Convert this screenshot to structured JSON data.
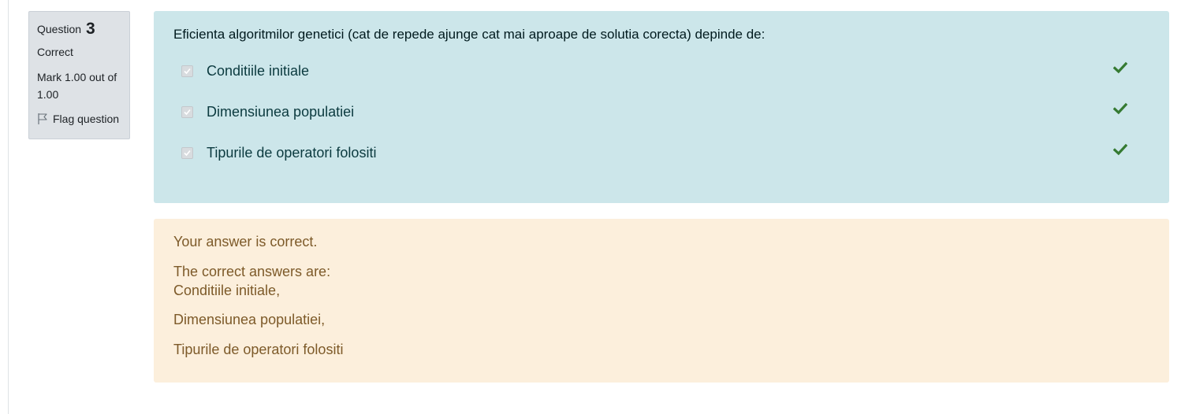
{
  "question_info": {
    "question_label": "Question",
    "question_number": "3",
    "state": "Correct",
    "grade": "Mark 1.00 out of 1.00",
    "flag_label": "Flag question"
  },
  "question": {
    "text": "Eficienta algoritmilor genetici (cat de repede ajunge cat mai aproape de solutia corecta) depinde de:",
    "answers": [
      {
        "label": "Conditiile initiale",
        "checked": true,
        "correct": true
      },
      {
        "label": "Dimensiunea populatiei",
        "checked": true,
        "correct": true
      },
      {
        "label": "Tipurile de operatori folositi",
        "checked": true,
        "correct": true
      }
    ]
  },
  "feedback": {
    "general": "Your answer is correct.",
    "heading": "The correct answers are:",
    "items": [
      "Conditiile initiale,",
      "Dimensiunea populatiei,",
      "Tipurile de operatori folositi"
    ]
  },
  "colors": {
    "question_bg": "#cce6ea",
    "feedback_bg": "#fcefdc",
    "info_bg": "#dee2e6",
    "correct_tick": "#357a32",
    "feedback_text": "#7d5a29"
  },
  "icons": {
    "flag": "flag-icon",
    "correct": "check-icon"
  }
}
